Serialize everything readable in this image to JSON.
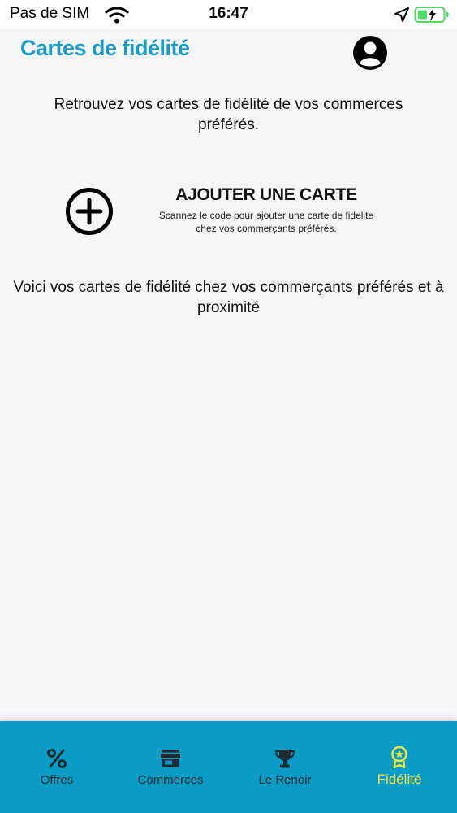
{
  "status_bar": {
    "carrier": "Pas de SIM",
    "time": "16:47"
  },
  "header": {
    "title": "Cartes de fidélité"
  },
  "intro": {
    "text": "Retrouvez vos cartes de fidélité de vos commerces préférés."
  },
  "add_card": {
    "title": "AJOUTER UNE CARTE",
    "subtitle_line1": "Scannez le code pour ajouter une carte de fidelite",
    "subtitle_line2": "chez vos commerçants préférés."
  },
  "cards_section": {
    "text": "Voici vos cartes de fidélité chez vos commerçants préférés et à proximité"
  },
  "tabs": [
    {
      "label": "Offres",
      "icon": "percent-icon"
    },
    {
      "label": "Commerces",
      "icon": "store-icon"
    },
    {
      "label": "Le Renoir",
      "icon": "trophy-icon"
    },
    {
      "label": "Fidélité",
      "icon": "award-badge-icon",
      "active": true
    }
  ],
  "colors": {
    "accent": "#1b9cc3",
    "tab_bar": "#0b9cc6",
    "active_tab": "#f2e43a",
    "battery": "#4cd964"
  }
}
